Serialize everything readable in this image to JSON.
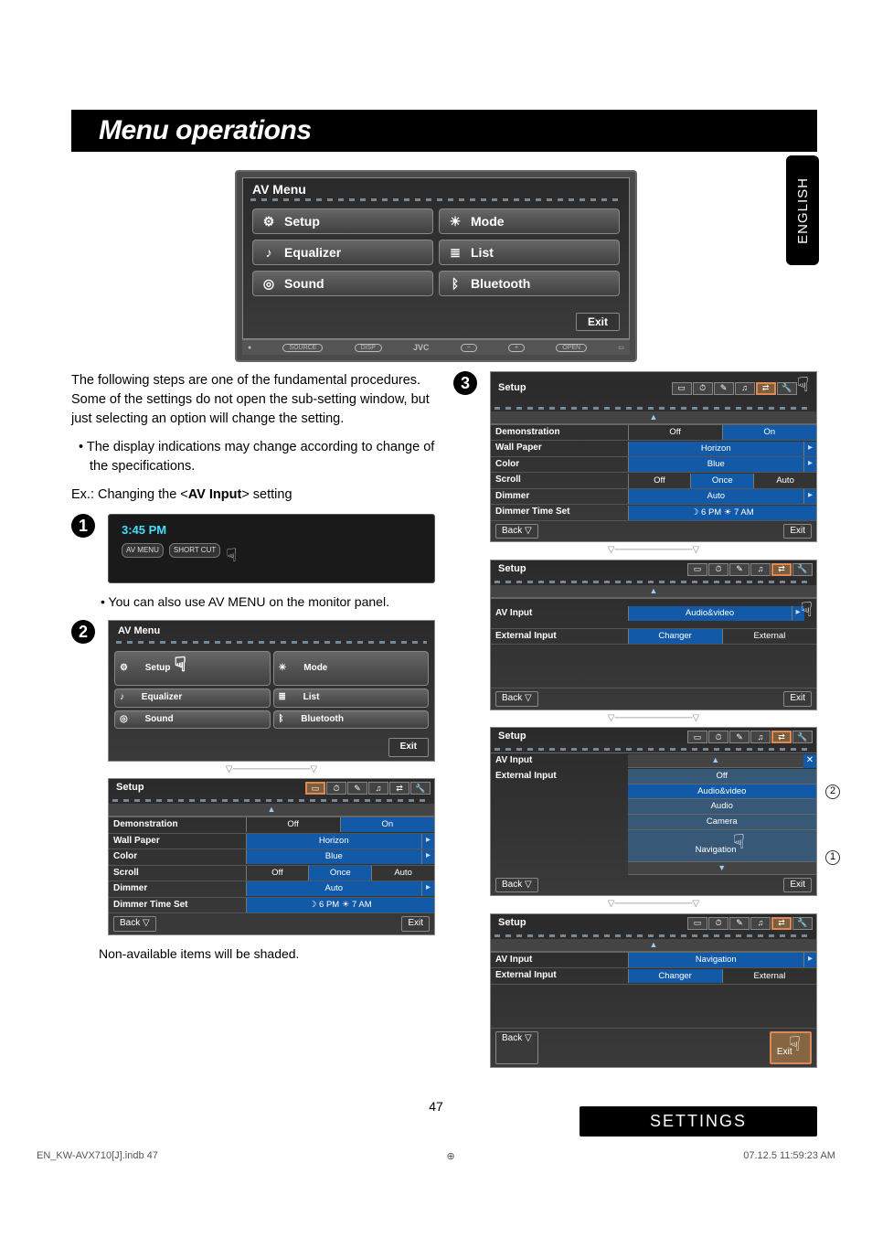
{
  "page_title": "Menu operations",
  "side_tab": "ENGLISH",
  "av_menu": {
    "title": "AV Menu",
    "items": [
      {
        "icon": "⚙",
        "label": "Setup"
      },
      {
        "icon": "☀",
        "label": "Mode"
      },
      {
        "icon": "♪",
        "label": "Equalizer"
      },
      {
        "icon": "≣",
        "label": "List"
      },
      {
        "icon": "◎",
        "label": "Sound"
      },
      {
        "icon": "ᛒ",
        "label": "Bluetooth"
      }
    ],
    "exit": "Exit"
  },
  "panel_strip": {
    "brand": "JVC",
    "buttons": [
      "SOURCE",
      "DISP",
      "−",
      "+",
      "OPEN"
    ]
  },
  "intro_para": "The following steps are one of the fundamental procedures. Some of the settings do not open the sub-setting window, but just selecting an option will change the setting.",
  "intro_bullet": "The display indications may change according to change of the specifications.",
  "ex_line_prefix": "Ex.: Changing the <",
  "ex_line_bold": "AV Input",
  "ex_line_suffix": "> setting",
  "step1_time": "3:45 PM",
  "step1_btn1": "AV MENU",
  "step1_btn2": "SHORT CUT",
  "step2_bullet": "You can also use AV MENU on the monitor panel.",
  "non_available": "Non-available items will be shaded.",
  "setup": {
    "title": "Setup",
    "tabs_icons": [
      "▭",
      "⏱",
      "✎",
      "♫",
      "⇄",
      "🔧"
    ],
    "rows": [
      {
        "lbl": "Demonstration",
        "opts": [
          "Off",
          "On"
        ],
        "sel": 1,
        "arrow": false
      },
      {
        "lbl": "Wall Paper",
        "opts": [
          "Horizon"
        ],
        "sel": 0,
        "arrow": true
      },
      {
        "lbl": "Color",
        "opts": [
          "Blue"
        ],
        "sel": 0,
        "arrow": true
      },
      {
        "lbl": "Scroll",
        "opts": [
          "Off",
          "Once",
          "Auto"
        ],
        "sel": 1,
        "arrow": false
      },
      {
        "lbl": "Dimmer",
        "opts": [
          "Auto"
        ],
        "sel": 0,
        "arrow": true
      },
      {
        "lbl": "Dimmer Time Set",
        "opts": [
          "☽ 6 PM  ☀ 7 AM"
        ],
        "sel": 0,
        "arrow": false
      }
    ],
    "back": "Back",
    "exit": "Exit"
  },
  "setup3b": {
    "rows": [
      {
        "lbl": "AV Input",
        "opts": [
          "Audio&video"
        ],
        "arrow": true
      },
      {
        "lbl": "External Input",
        "opts": [
          "Changer",
          "External"
        ],
        "arrow": false
      }
    ]
  },
  "setup3c": {
    "rows": [
      {
        "lbl": "AV Input"
      },
      {
        "lbl": "External Input"
      }
    ],
    "dropdown": [
      "Off",
      "Audio&video",
      "Audio",
      "Camera",
      "Navigation"
    ],
    "circ1": "1",
    "circ2": "2"
  },
  "setup3d": {
    "rows": [
      {
        "lbl": "AV Input",
        "opts": [
          "Navigation"
        ],
        "arrow": true
      },
      {
        "lbl": "External Input",
        "opts": [
          "Changer",
          "External"
        ],
        "arrow": false
      }
    ]
  },
  "page_number": "47",
  "footer_settings": "SETTINGS",
  "footer_file": "EN_KW-AVX710[J].indb   47",
  "footer_time": "07.12.5   11:59:23 AM"
}
